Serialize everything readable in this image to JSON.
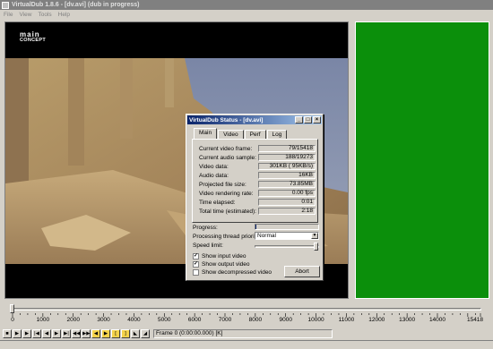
{
  "window": {
    "title": "VirtualDub 1.8.6 - [dv.avi] (dub in progress)"
  },
  "menu": [
    "File",
    "View",
    "Tools",
    "Help"
  ],
  "logo": {
    "line1": "main",
    "line2": "CONCEPT"
  },
  "status_dialog": {
    "title": "VirtualDub Status - [dv.avi]",
    "tabs": [
      "Main",
      "Video",
      "Perf",
      "Log"
    ],
    "stats": [
      {
        "label": "Current video frame:",
        "value": "79/15418"
      },
      {
        "label": "Current audio sample:",
        "value": "188/19273"
      },
      {
        "label": "Video data:",
        "value": "301KB ( 95KB/s)"
      },
      {
        "label": "Audio data:",
        "value": "16KB"
      },
      {
        "label": "Projected file size:",
        "value": "73.85MB"
      },
      {
        "label": "Video rendering rate:",
        "value": "0.00 fps"
      },
      {
        "label": "Time elapsed:",
        "value": "0:01"
      },
      {
        "label": "Total time (estimated):",
        "value": "2:18"
      }
    ],
    "progress_label": "Progress:",
    "progress_fraction": 0.005,
    "priority_label": "Processing thread priority:",
    "priority_value": "Normal",
    "speed_label": "Speed limit:",
    "speed_fraction": 1.0,
    "checkboxes": [
      {
        "label": "Show input video",
        "checked": true
      },
      {
        "label": "Show output video",
        "checked": true
      },
      {
        "label": "Show decompressed video",
        "checked": false
      }
    ],
    "abort_label": "Abort"
  },
  "timeline": {
    "ticks": [
      "0",
      "1000",
      "2000",
      "3000",
      "4000",
      "5000",
      "6000",
      "7000",
      "8000",
      "9000",
      "10000",
      "11000",
      "12000",
      "13000",
      "14000",
      "15418"
    ],
    "tick_values": [
      0,
      1000,
      2000,
      3000,
      4000,
      5000,
      6000,
      7000,
      8000,
      9000,
      10000,
      11000,
      12000,
      13000,
      14000,
      15418
    ],
    "max": 15418,
    "position": 0
  },
  "frame_readout": "Frame 0 (0:00:00.000) [K]",
  "colors": {
    "output_pane": "#0b8f0b",
    "title_active": "#0a246a",
    "title_inactive": "#808080"
  }
}
